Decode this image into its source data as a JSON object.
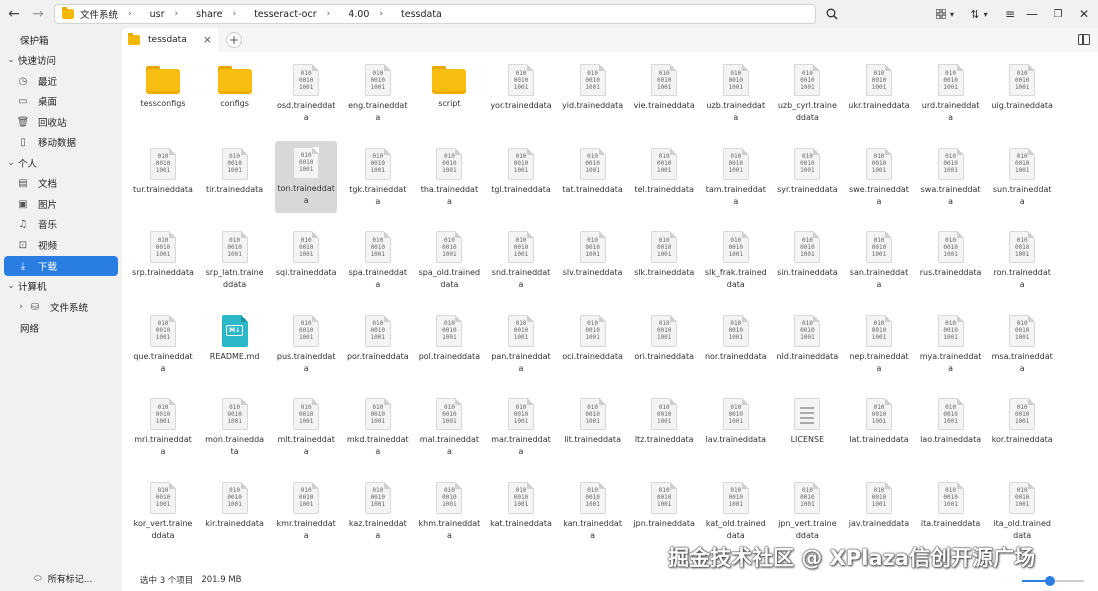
{
  "path": [
    "文件系统",
    "usr",
    "share",
    "tesseract-ocr",
    "4.00",
    "tessdata"
  ],
  "sidebar": {
    "vault": "保护箱",
    "quick_access": "快速访问",
    "quick_items": [
      "最近",
      "桌面",
      "回收站",
      "移动数据"
    ],
    "personal": "个人",
    "personal_items": [
      "文档",
      "图片",
      "音乐",
      "视频",
      "下载"
    ],
    "computer": "计算机",
    "computer_items": [
      "文件系统"
    ],
    "network": "网络",
    "footer": "所有标记..."
  },
  "tab": {
    "label": "tessdata"
  },
  "status": {
    "selected": "选中 3 个项目",
    "size": "201.9 MB"
  },
  "zoom_fraction": 0.45,
  "watermark": "掘金技术社区 @ XPlaza信创开源广场",
  "icons": {
    "back": "arrow-left-icon",
    "forward": "arrow-right-icon",
    "search": "search-icon",
    "view": "grid-view-icon",
    "sort": "sort-icon",
    "menu": "hamburger-icon"
  },
  "files": [
    {
      "name": "tessconfigs",
      "type": "folder"
    },
    {
      "name": "configs",
      "type": "folder"
    },
    {
      "name": "osd.traineddata",
      "type": "bin"
    },
    {
      "name": "eng.traineddata",
      "type": "bin"
    },
    {
      "name": "script",
      "type": "folder"
    },
    {
      "name": "yor.traineddata",
      "type": "bin"
    },
    {
      "name": "yid.traineddata",
      "type": "bin"
    },
    {
      "name": "vie.traineddata",
      "type": "bin"
    },
    {
      "name": "uzb.traineddata",
      "type": "bin"
    },
    {
      "name": "uzb_cyrl.traineddata",
      "type": "bin"
    },
    {
      "name": "ukr.traineddata",
      "type": "bin"
    },
    {
      "name": "urd.traineddata",
      "type": "bin"
    },
    {
      "name": "uig.traineddata",
      "type": "bin"
    },
    {
      "name": "tur.traineddata",
      "type": "bin"
    },
    {
      "name": "tir.traineddata",
      "type": "bin"
    },
    {
      "name": "ton.traineddata",
      "type": "bin",
      "selected": true
    },
    {
      "name": "tgk.traineddata",
      "type": "bin"
    },
    {
      "name": "tha.traineddata",
      "type": "bin"
    },
    {
      "name": "tgl.traineddata",
      "type": "bin"
    },
    {
      "name": "tat.traineddata",
      "type": "bin"
    },
    {
      "name": "tel.traineddata",
      "type": "bin"
    },
    {
      "name": "tam.traineddata",
      "type": "bin"
    },
    {
      "name": "syr.traineddata",
      "type": "bin"
    },
    {
      "name": "swe.traineddata",
      "type": "bin"
    },
    {
      "name": "swa.traineddata",
      "type": "bin"
    },
    {
      "name": "sun.traineddata",
      "type": "bin"
    },
    {
      "name": "srp.traineddata",
      "type": "bin"
    },
    {
      "name": "srp_latn.traineddata",
      "type": "bin"
    },
    {
      "name": "sqi.traineddata",
      "type": "bin"
    },
    {
      "name": "spa.traineddata",
      "type": "bin"
    },
    {
      "name": "spa_old.traineddata",
      "type": "bin"
    },
    {
      "name": "snd.traineddata",
      "type": "bin"
    },
    {
      "name": "slv.traineddata",
      "type": "bin"
    },
    {
      "name": "slk.traineddata",
      "type": "bin"
    },
    {
      "name": "slk_frak.traineddata",
      "type": "bin"
    },
    {
      "name": "sin.traineddata",
      "type": "bin"
    },
    {
      "name": "san.traineddata",
      "type": "bin"
    },
    {
      "name": "rus.traineddata",
      "type": "bin"
    },
    {
      "name": "ron.traineddata",
      "type": "bin"
    },
    {
      "name": "que.traineddata",
      "type": "bin"
    },
    {
      "name": "README.md",
      "type": "md"
    },
    {
      "name": "pus.traineddata",
      "type": "bin"
    },
    {
      "name": "por.traineddata",
      "type": "bin"
    },
    {
      "name": "pol.traineddata",
      "type": "bin"
    },
    {
      "name": "pan.traineddata",
      "type": "bin"
    },
    {
      "name": "oci.traineddata",
      "type": "bin"
    },
    {
      "name": "ori.traineddata",
      "type": "bin"
    },
    {
      "name": "nor.traineddata",
      "type": "bin"
    },
    {
      "name": "nld.traineddata",
      "type": "bin"
    },
    {
      "name": "nep.traineddata",
      "type": "bin"
    },
    {
      "name": "mya.traineddata",
      "type": "bin"
    },
    {
      "name": "msa.traineddata",
      "type": "bin"
    },
    {
      "name": "mri.traineddata",
      "type": "bin"
    },
    {
      "name": "mon.traineddata",
      "type": "bin"
    },
    {
      "name": "mlt.traineddata",
      "type": "bin"
    },
    {
      "name": "mkd.traineddata",
      "type": "bin"
    },
    {
      "name": "mal.traineddata",
      "type": "bin"
    },
    {
      "name": "mar.traineddata",
      "type": "bin"
    },
    {
      "name": "lit.traineddata",
      "type": "bin"
    },
    {
      "name": "ltz.traineddata",
      "type": "bin"
    },
    {
      "name": "lav.traineddata",
      "type": "bin"
    },
    {
      "name": "LICENSE",
      "type": "txt"
    },
    {
      "name": "lat.traineddata",
      "type": "bin"
    },
    {
      "name": "lao.traineddata",
      "type": "bin"
    },
    {
      "name": "kor.traineddata",
      "type": "bin"
    },
    {
      "name": "kor_vert.traineddata",
      "type": "bin"
    },
    {
      "name": "kir.traineddata",
      "type": "bin"
    },
    {
      "name": "kmr.traineddata",
      "type": "bin"
    },
    {
      "name": "kaz.traineddata",
      "type": "bin"
    },
    {
      "name": "khm.traineddata",
      "type": "bin"
    },
    {
      "name": "kat.traineddata",
      "type": "bin"
    },
    {
      "name": "kan.traineddata",
      "type": "bin"
    },
    {
      "name": "jpn.traineddata",
      "type": "bin"
    },
    {
      "name": "kat_old.traineddata",
      "type": "bin"
    },
    {
      "name": "jpn_vert.traineddata",
      "type": "bin"
    },
    {
      "name": "jav.traineddata",
      "type": "bin"
    },
    {
      "name": "ita.traineddata",
      "type": "bin"
    },
    {
      "name": "ita_old.traineddata",
      "type": "bin"
    }
  ]
}
